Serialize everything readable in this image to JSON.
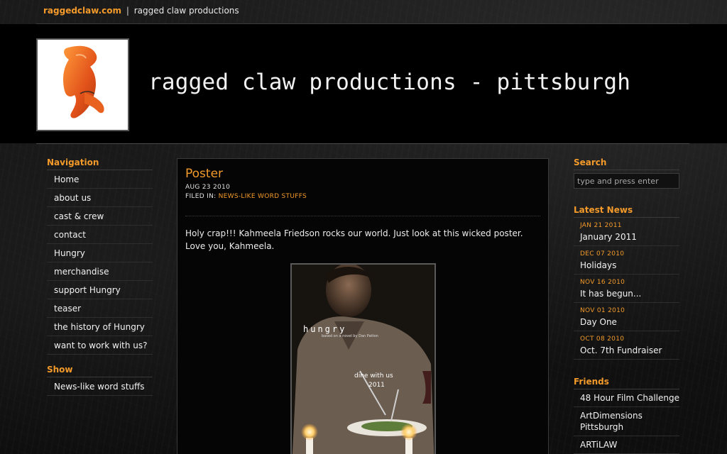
{
  "topbar": {
    "site_link": "raggedclaw.com",
    "separator": "|",
    "tagline": "ragged claw productions"
  },
  "header": {
    "title": "ragged claw productions - pittsburgh",
    "logo_icon": "lobster-claw-icon"
  },
  "sidebar_left": {
    "navigation_heading": "Navigation",
    "navigation_items": [
      "Home",
      "about us",
      "cast & crew",
      "contact",
      "Hungry",
      "merchandise",
      "support Hungry",
      "teaser",
      "the history of Hungry",
      "want to work with us?"
    ],
    "show_heading": "Show",
    "show_items": [
      "News-like word stuffs"
    ]
  },
  "post": {
    "title": "Poster",
    "date": "AUG 23 2010",
    "filed_label": "FILED IN:",
    "category": "NEWS-LIKE WORD STUFFS",
    "body": "Holy crap!!!  Kahmeela Friedson rocks our world.  Just look at this wicked poster.  Love you, Kahmeela.",
    "poster": {
      "title": "hungry",
      "subtitle": "based on a novel by Dan Patton",
      "tagline": "dine with us",
      "year": "2011"
    }
  },
  "sidebar_right": {
    "search_heading": "Search",
    "search_placeholder": "type and press enter",
    "news_heading": "Latest News",
    "news_items": [
      {
        "date": "JAN 21 2011",
        "title": "January 2011"
      },
      {
        "date": "DEC 07 2010",
        "title": "Holidays"
      },
      {
        "date": "NOV 16 2010",
        "title": "It has begun..."
      },
      {
        "date": "NOV 01 2010",
        "title": "Day One"
      },
      {
        "date": "OCT 08 2010",
        "title": "Oct. 7th Fundraiser"
      }
    ],
    "friends_heading": "Friends",
    "friends_items": [
      "48 Hour Film Challenge",
      "ArtDimensions Pittsburgh",
      "ARTiLAW"
    ]
  },
  "colors": {
    "accent": "#f39a2a",
    "background": "#0b0b0b",
    "text": "#f2f2f2"
  }
}
